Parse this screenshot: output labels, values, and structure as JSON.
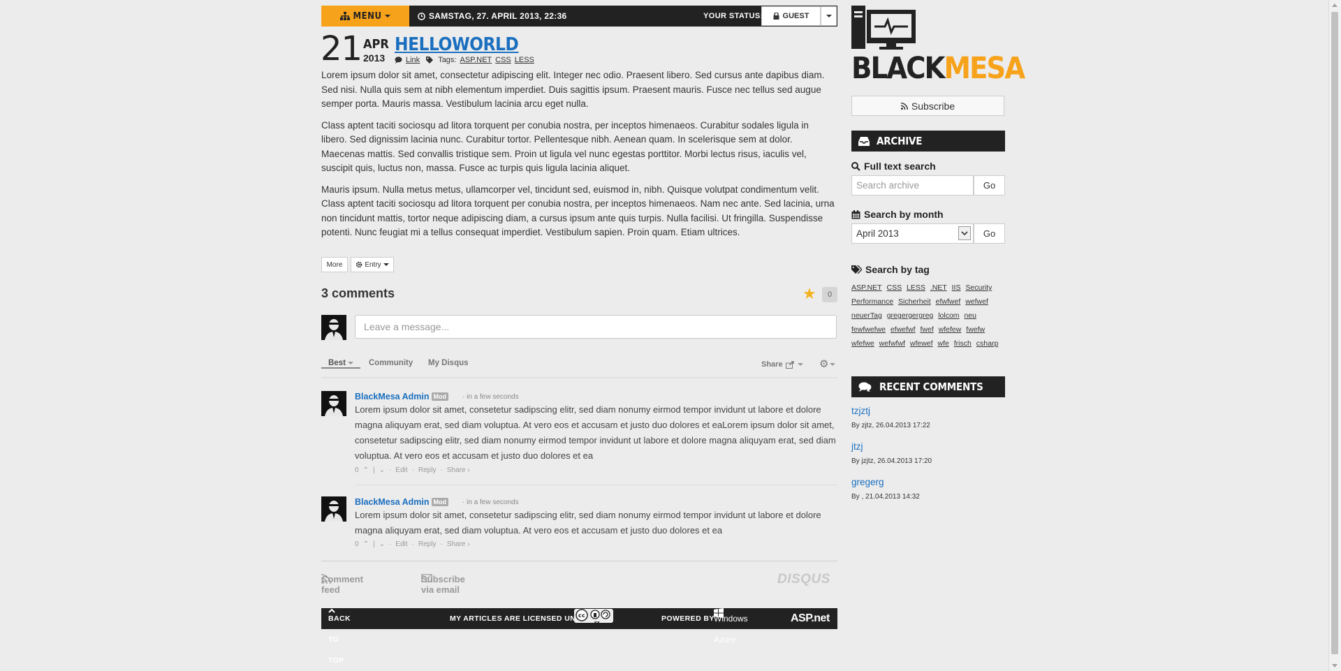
{
  "topbar": {
    "menu_label": "MENU",
    "datetime": "SAMSTAG, 27. APRIL 2013, 22:36",
    "status_label": "YOUR STATUS:",
    "guest_label": "GUEST"
  },
  "post": {
    "day": "21",
    "month": "APR",
    "year": "2013",
    "title": "HELLOWORLD",
    "link_label": "Link",
    "tags_label": "Tags:",
    "tags": [
      "ASP.NET",
      "CSS",
      "LESS"
    ],
    "paragraphs": [
      "Lorem ipsum dolor sit amet, consectetur adipiscing elit. Integer nec odio. Praesent libero. Sed cursus ante dapibus diam. Sed nisi. Nulla quis sem at nibh elementum imperdiet. Duis sagittis ipsum. Praesent mauris. Fusce nec tellus sed augue semper porta. Mauris massa. Vestibulum lacinia arcu eget nulla.",
      "Class aptent taciti sociosqu ad litora torquent per conubia nostra, per inceptos himenaeos. Curabitur sodales ligula in libero. Sed dignissim lacinia nunc. Curabitur tortor. Pellentesque nibh. Aenean quam. In scelerisque sem at dolor. Maecenas mattis. Sed convallis tristique sem. Proin ut ligula vel nunc egestas porttitor. Morbi lectus risus, iaculis vel, suscipit quis, luctus non, massa. Fusce ac turpis quis ligula lacinia aliquet.",
      "Mauris ipsum. Nulla metus metus, ullamcorper vel, tincidunt sed, euismod in, nibh. Quisque volutpat condimentum velit. Class aptent taciti sociosqu ad litora torquent per conubia nostra, per inceptos himenaeos. Nam nec ante. Sed lacinia, urna non tincidunt mattis, tortor neque adipiscing diam, a cursus ipsum ante quis turpis. Nulla facilisi. Ut fringilla. Suspendisse potenti. Nunc feugiat mi a tellus consequat imperdiet. Vestibulum sapien. Proin quam. Etiam ultrices."
    ],
    "more_label": "More",
    "entry_label": "Entry"
  },
  "disqus": {
    "comments_title": "3 comments",
    "star_count": "0",
    "input_placeholder": "Leave a message...",
    "tabs": [
      "Best",
      "Community",
      "My Disqus"
    ],
    "share_label": "Share",
    "comments": [
      {
        "author": "BlackMesa Admin",
        "badge": "Mod",
        "time": "in a few seconds",
        "text": "Lorem ipsum dolor sit amet, consetetur sadipscing elitr, sed diam nonumy eirmod tempor invidunt ut labore et dolore magna aliquyam erat, sed diam voluptua. At vero eos et accusam et justo duo dolores et eaLorem ipsum dolor sit amet, consetetur sadipscing elitr, sed diam nonumy eirmod tempor invidunt ut labore et dolore magna aliquyam erat, sed diam voluptua. At vero eos et accusam et justo duo dolores et ea",
        "votes": "0",
        "edit": "Edit",
        "reply": "Reply",
        "share": "Share ›"
      },
      {
        "author": "BlackMesa Admin",
        "badge": "Mod",
        "time": "in a few seconds",
        "text": "Lorem ipsum dolor sit amet, consetetur sadipscing elitr, sed diam nonumy eirmod tempor invidunt ut labore et dolore magna aliquyam erat, sed diam voluptua. At vero eos et accusam et justo duo dolores et ea",
        "votes": "0",
        "edit": "Edit",
        "reply": "Reply",
        "share": "Share ›"
      }
    ],
    "comment_feed": "Comment feed",
    "subscribe_email": "Subscribe via email",
    "brand": "DISQUS"
  },
  "footer": {
    "back_to_top": "BACK TO TOP",
    "license_label": "MY ARTICLES ARE LICENSED UNDER",
    "cc_by": "BY",
    "cc_sa": "SA",
    "powered_by": "POWERED BY",
    "azure": "Windows Azure",
    "aspnet": "ASP.net"
  },
  "sidebar": {
    "logo_black": "BLACK",
    "logo_orange": "MESA",
    "subscribe_label": "Subscribe",
    "archive_title": "ARCHIVE",
    "fulltext_label": "Full text search",
    "search_placeholder": "Search archive",
    "go_label": "Go",
    "month_label": "Search by month",
    "month_value": "April 2013",
    "tag_label": "Search by tag",
    "tags": [
      "ASP.NET",
      "CSS",
      "LESS",
      ".NET",
      "IIS",
      "Security",
      "Performance",
      "Sicherheit",
      "efwfwef",
      "wefwef",
      "neuerTag",
      "gregergergreg",
      "lolcom",
      "neu",
      "fewfwefwe",
      "efwefwf",
      "fwef",
      "wfefew",
      "fwefw",
      "wfefwe",
      "wefwfwf",
      "wfewef",
      "wfe",
      "frisch",
      "csharp"
    ],
    "recent_title": "RECENT COMMENTS",
    "recent": [
      {
        "title": "tzjztj",
        "by": "By zjtz, 26.04.2013 17:22"
      },
      {
        "title": "jtzj",
        "by": "By jzjtz, 26.04.2013 17:20"
      },
      {
        "title": "gregerg",
        "by": "By , 21.04.2013 14:32"
      }
    ]
  },
  "colors": {
    "accent_orange": "#f7a21b",
    "link_blue": "#1a6fbf",
    "bar_dark": "#222222",
    "background": "#ececec"
  },
  "icons": [
    "sitemap-icon",
    "clock-icon",
    "lock-icon",
    "comment-icon",
    "tags-icon",
    "cog-icon",
    "star-icon",
    "share-icon",
    "gear-icon",
    "rss-icon",
    "envelope-icon",
    "chevron-up-icon",
    "creative-commons-icon",
    "windows-icon",
    "inbox-icon",
    "search-icon",
    "calendar-icon",
    "comments-icon",
    "computer-logo-icon"
  ]
}
